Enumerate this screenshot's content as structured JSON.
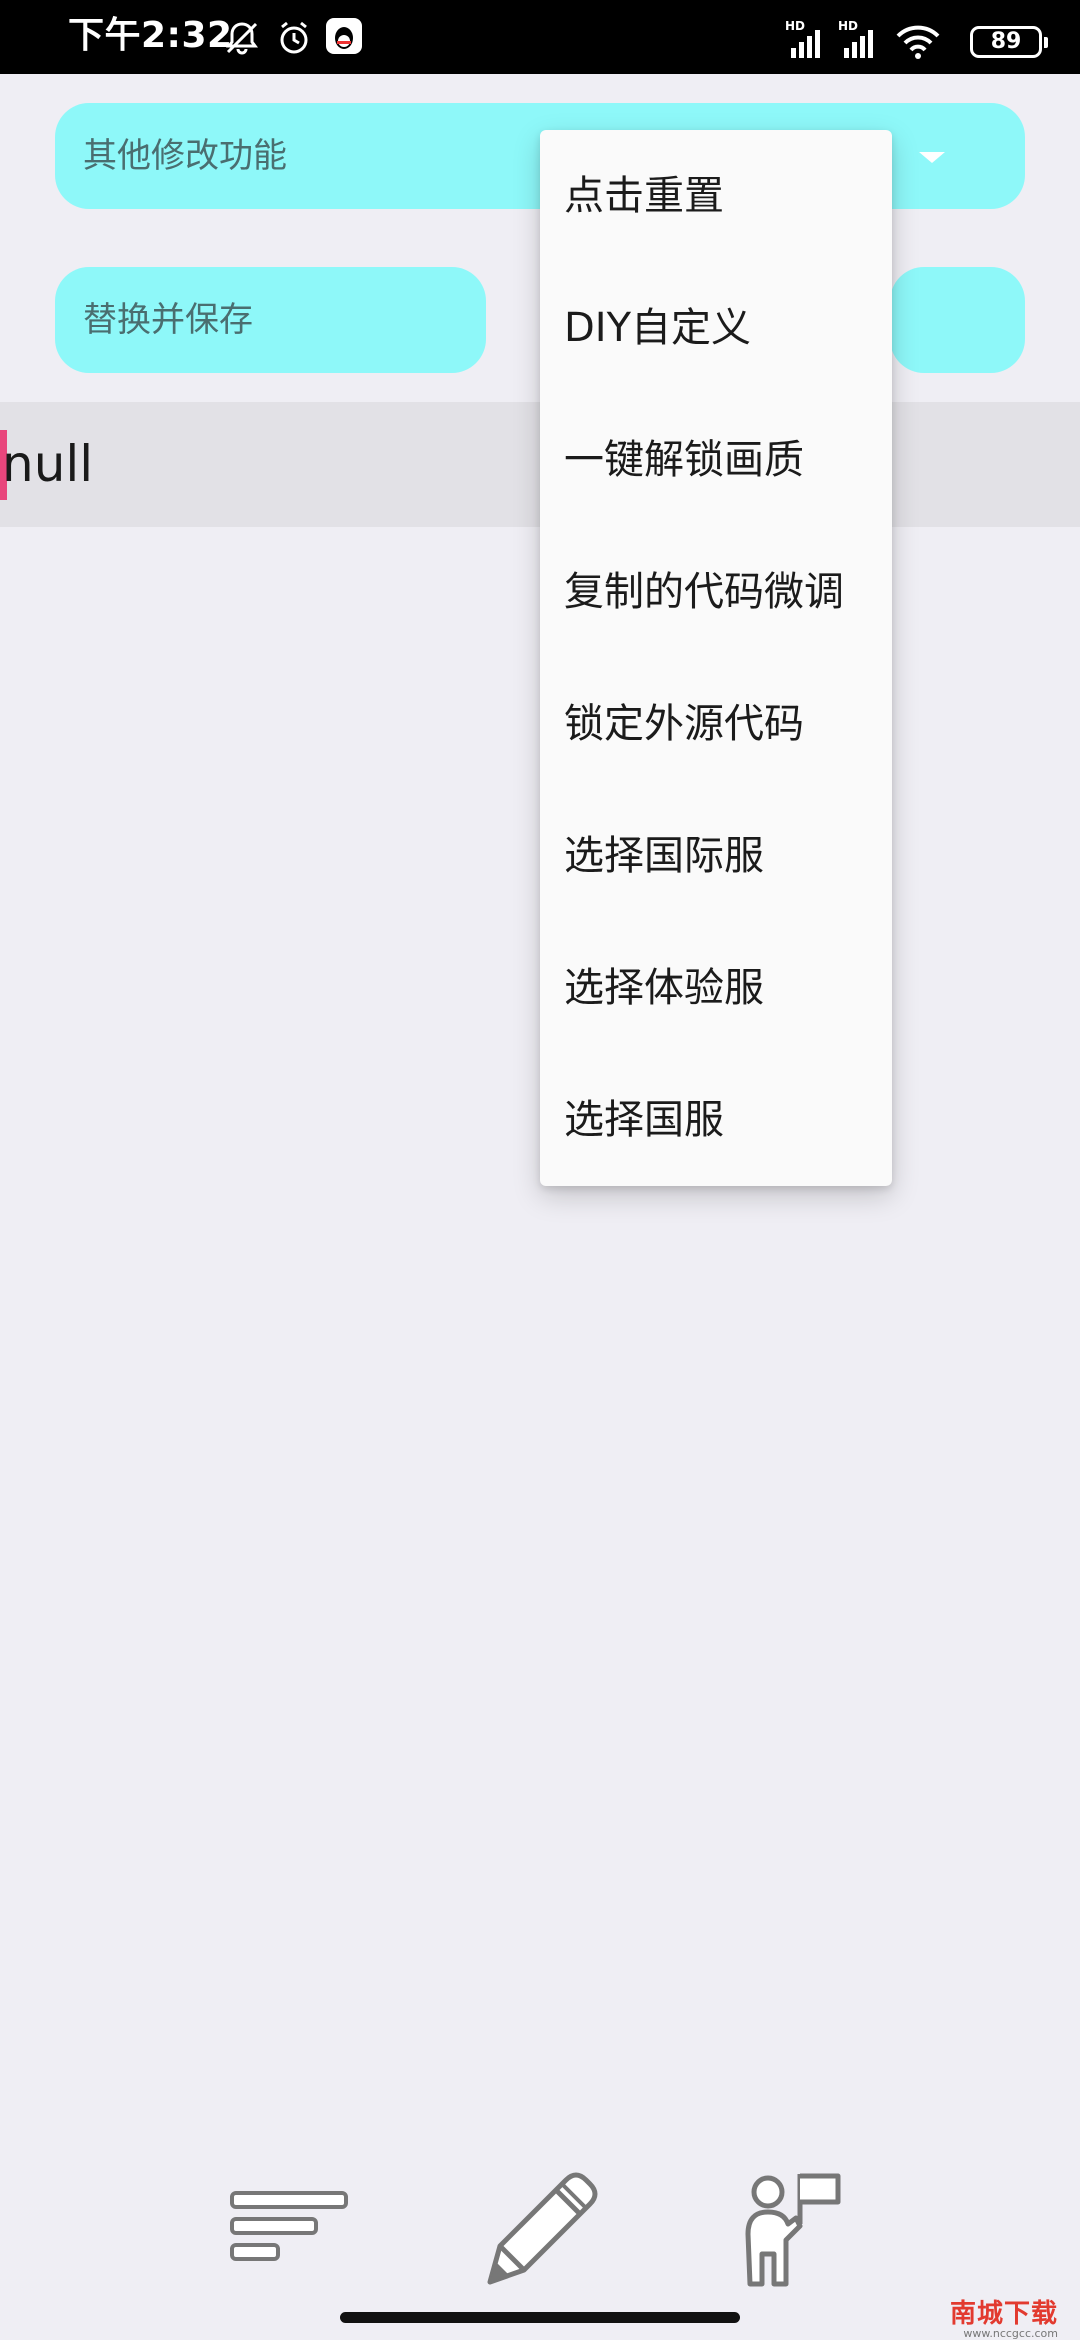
{
  "status_bar": {
    "time": "下午2:32",
    "network_label_1": "HD",
    "network_label_2": "HD",
    "battery": "89",
    "icons": [
      "mute-bell-icon",
      "alarm-icon",
      "qq-icon",
      "signal-icon",
      "signal-icon",
      "wifi-icon",
      "battery-icon"
    ]
  },
  "spinner": {
    "selected_value": "其他修改功能",
    "arrow_icon": "dropdown-arrow-icon"
  },
  "actions": {
    "replace_save_label": "替换并保存"
  },
  "result": {
    "text": "null"
  },
  "dropdown": {
    "items": [
      "点击重置",
      "DIY自定义",
      "一键解锁画质",
      "复制的代码微调",
      "锁定外源代码",
      "选择国际服",
      "选择体验服",
      "选择国服"
    ]
  },
  "bottom_nav": {
    "icons": [
      "list-icon",
      "pencil-icon",
      "person-flag-icon"
    ]
  },
  "watermark": {
    "main": "南城下载",
    "sub": "www.nccgcc.com"
  },
  "colors": {
    "accent_cyan": "#8ef8f9",
    "background": "#efeef4",
    "marker_pink": "#e8467c"
  }
}
